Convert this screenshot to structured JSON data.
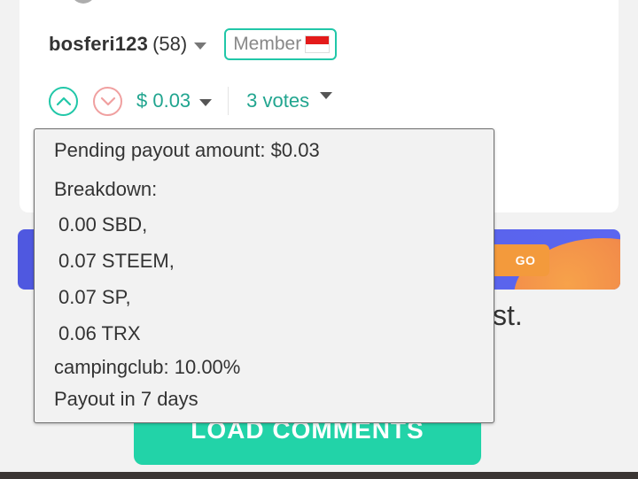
{
  "post": {
    "author": "bosferi123",
    "reputation": "(58)",
    "badge": "Member",
    "payout": "$ 0.03",
    "votes": "3 votes"
  },
  "banner": {
    "go_label": "GO"
  },
  "background": {
    "partial_text": "st."
  },
  "load_comments": {
    "label": "LOAD COMMENTS"
  },
  "tooltip": {
    "pending": "Pending payout amount: $0.03",
    "breakdown_label": "Breakdown:",
    "items": [
      "0.00 SBD,",
      "0.07 STEEM,",
      "0.07 SP,",
      "0.06 TRX"
    ],
    "beneficiary": "campingclub: 10.00%",
    "payout_time": "Payout in 7 days"
  },
  "colors": {
    "accent": "#21c7a8",
    "payout_text": "#21a58f",
    "downvote": "#f0a0a0",
    "banner": "#5862ea",
    "go_button": "#f39a3c",
    "load_button": "#22d3a8"
  },
  "flag_icon": "indonesia-flag-icon"
}
